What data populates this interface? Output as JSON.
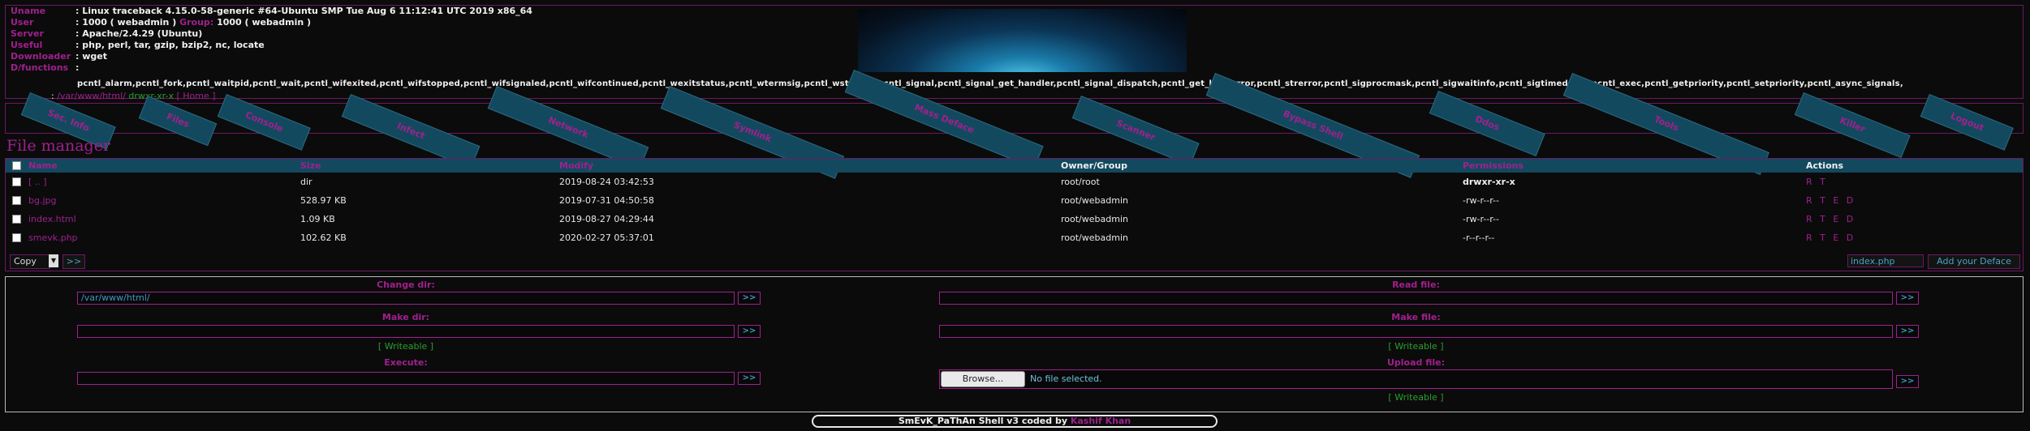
{
  "info": {
    "uname_label": "Uname",
    "uname_value": "Linux traceback 4.15.0-58-generic #64-Ubuntu SMP Tue Aug 6 11:12:41 UTC 2019 x86_64",
    "user_label": "User",
    "user_value": "1000 ( webadmin )",
    "group_label": "Group:",
    "group_value": "1000 ( webadmin )",
    "server_label": "Server",
    "server_value": "Apache/2.4.29 (Ubuntu)",
    "useful_label": "Useful",
    "useful_value": "php, perl, tar, gzip, bzip2, nc, locate",
    "downloader_label": "Downloader",
    "downloader_value": "wget",
    "dfunctions_label": "D/functions",
    "dfunctions_value": "pcntl_alarm,pcntl_fork,pcntl_waitpid,pcntl_wait,pcntl_wifexited,pcntl_wifstopped,pcntl_wifsignaled,pcntl_wifcontinued,pcntl_wexitstatus,pcntl_wtermsig,pcntl_wstopsig,pcntl_signal,pcntl_signal_get_handler,pcntl_signal_dispatch,pcntl_get_last_error,pcntl_strerror,pcntl_sigprocmask,pcntl_sigwaitinfo,pcntl_sigtimedwait,pcntl_exec,pcntl_getpriority,pcntl_setpriority,pcntl_async_signals,",
    "cwd_value": "/var/www/html/",
    "cwd_perms": "drwxr-xr-x",
    "cwd_suffix": "[ Home ]"
  },
  "nav": [
    "Sec. Info",
    "Files",
    "Console",
    "Infect",
    "Network",
    "Symlink",
    "Mass Deface",
    "Scanner",
    "Bypass Shell",
    "Ddos",
    "Tools",
    "Killer",
    "Logout"
  ],
  "file_manager": {
    "title": "File manager",
    "columns": [
      "Name",
      "Size",
      "Modify",
      "Owner/Group",
      "Permissions",
      "Actions"
    ],
    "rows": [
      {
        "name": "[ .. ]",
        "size": "dir",
        "modify": "2019-08-24 03:42:53",
        "owner": "root/root",
        "perms": "drwxr-xr-x",
        "actions": "R T"
      },
      {
        "name": "bg.jpg",
        "size": "528.97 KB",
        "modify": "2019-07-31 04:50:58",
        "owner": "root/webadmin",
        "perms": "-rw-r--r--",
        "actions": "R T E D"
      },
      {
        "name": "index.html",
        "size": "1.09 KB",
        "modify": "2019-08-27 04:29:44",
        "owner": "root/webadmin",
        "perms": "-rw-r--r--",
        "actions": "R T E D"
      },
      {
        "name": "smevk.php",
        "size": "102.62 KB",
        "modify": "2020-02-27 05:37:01",
        "owner": "root/webadmin",
        "perms": "-r--r--r--",
        "actions": "R T E D"
      }
    ],
    "copy_select": "Copy",
    "go_label": ">>",
    "deface_file": "index.php",
    "deface_button": "Add your Deface"
  },
  "forms": {
    "change_dir_label": "Change dir:",
    "change_dir_value": "/var/www/html/",
    "read_file_label": "Read file:",
    "make_dir_label": "Make dir:",
    "make_file_label": "Make file:",
    "writeable": "[ Writeable ]",
    "execute_label": "Execute:",
    "upload_label": "Upload file:",
    "browse_button": "Browse...",
    "no_file": "No file selected.",
    "go": ">>"
  },
  "footer": {
    "text": "SmEvK_PaThAn Shell v3 coded by",
    "author": "Kashif Khan"
  },
  "colors": {
    "accent_purple": "#a0208e",
    "header_teal": "#13495e",
    "ok_green": "#2e9e2e",
    "link_blue": "#3a9ac4"
  }
}
